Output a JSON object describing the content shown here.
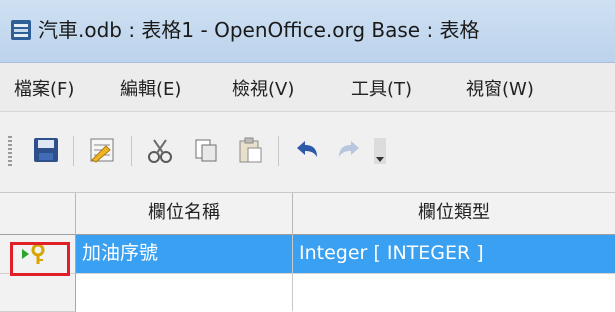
{
  "window": {
    "title": "汽車.odb : 表格1 - OpenOffice.org Base : 表格"
  },
  "menu": {
    "items": [
      "檔案(F)",
      "編輯(E)",
      "檢視(V)",
      "工具(T)",
      "視窗(W)"
    ]
  },
  "toolbar": {
    "icons": [
      "save-icon",
      "design-icon",
      "cut-icon",
      "copy-icon",
      "paste-icon",
      "undo-icon",
      "redo-icon",
      "dropdown-arrow-icon"
    ]
  },
  "table": {
    "headers": {
      "field_name": "欄位名稱",
      "field_type": "欄位類型"
    },
    "rows": [
      {
        "field_name": "加油序號",
        "field_type": "Integer [ INTEGER ]",
        "primary_key": true,
        "selected": true
      }
    ]
  },
  "colors": {
    "selection": "#3aa0f2",
    "highlight": "#e01f26"
  }
}
